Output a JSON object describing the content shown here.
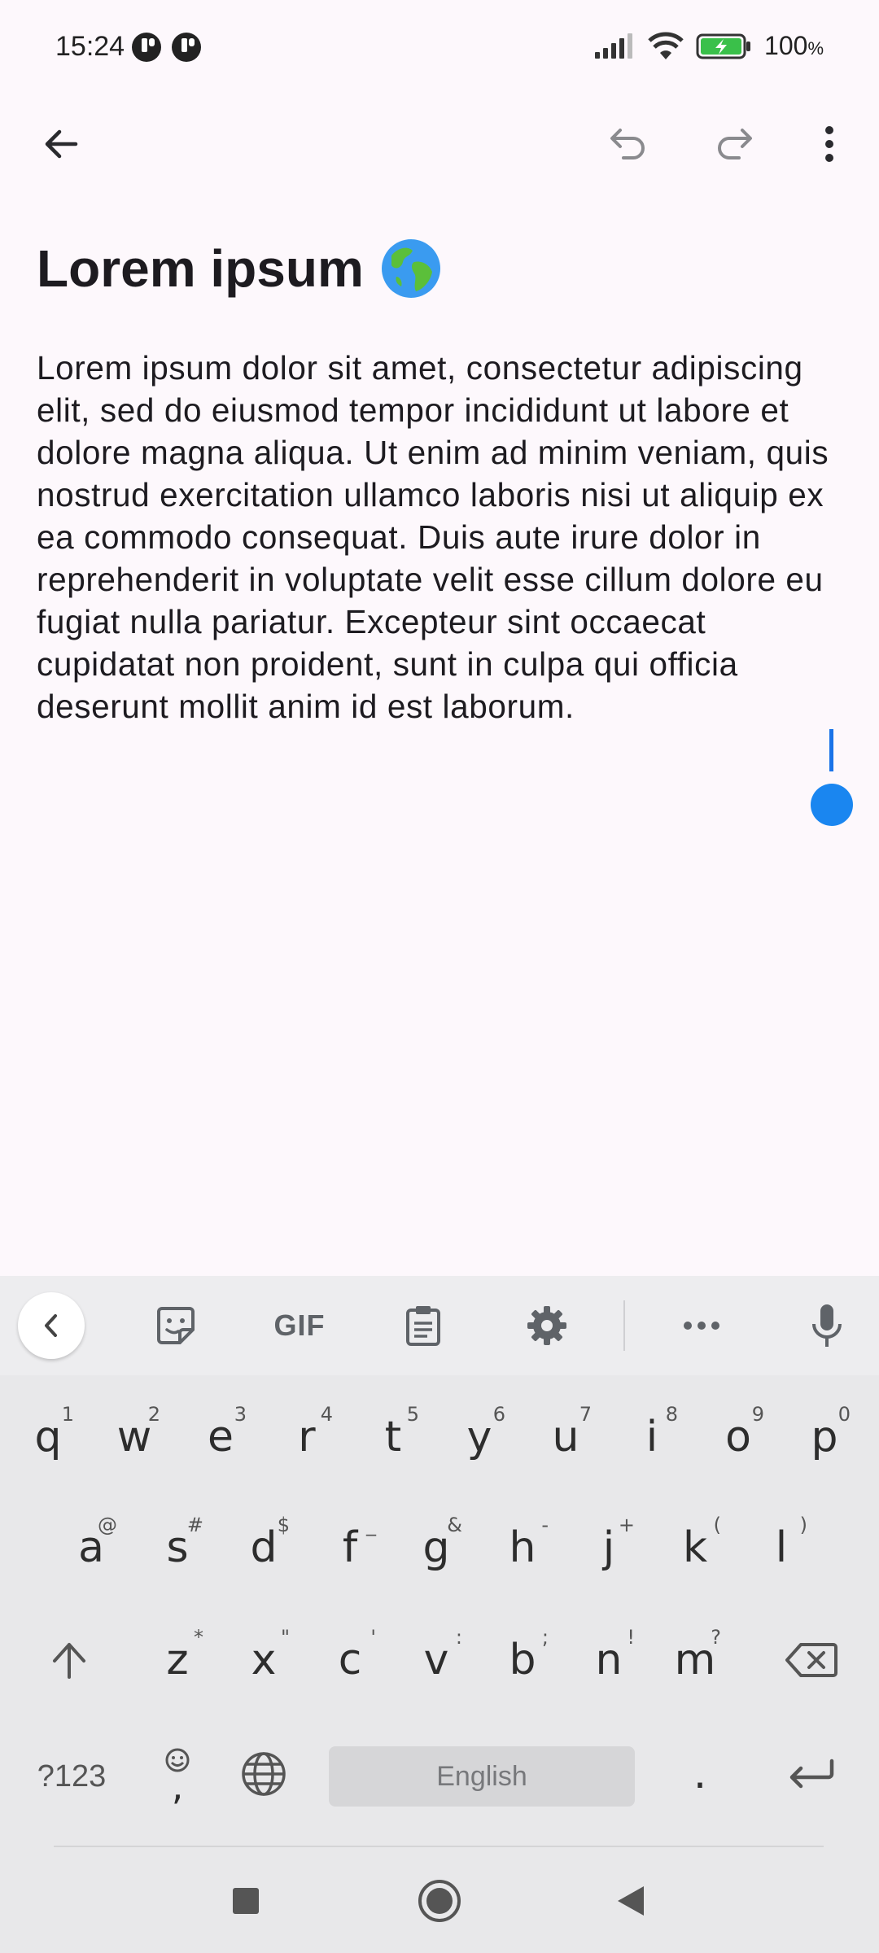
{
  "status_bar": {
    "time": "15:24",
    "battery_percent": "100",
    "battery_percent_symbol": "%"
  },
  "note": {
    "title": "Lorem ipsum",
    "title_emoji": "🌍",
    "body": "Lorem ipsum dolor sit amet, consectetur adipiscing elit, sed do eiusmod tempor incididunt ut labore et dolore magna aliqua. Ut enim ad minim veniam, quis nostrud exercitation ullamco laboris nisi ut aliquip ex ea commodo consequat. Duis aute irure dolor in reprehenderit in voluptate velit esse cillum dolore eu fugiat nulla pariatur. Excepteur sint occaecat cupidatat non proident, sunt in culpa qui officia deserunt mollit anim id est laborum."
  },
  "keyboard": {
    "toolbar": {
      "gif_label": "GIF"
    },
    "row1": [
      {
        "key": "q",
        "hint": "1"
      },
      {
        "key": "w",
        "hint": "2"
      },
      {
        "key": "e",
        "hint": "3"
      },
      {
        "key": "r",
        "hint": "4"
      },
      {
        "key": "t",
        "hint": "5"
      },
      {
        "key": "y",
        "hint": "6"
      },
      {
        "key": "u",
        "hint": "7"
      },
      {
        "key": "i",
        "hint": "8"
      },
      {
        "key": "o",
        "hint": "9"
      },
      {
        "key": "p",
        "hint": "0"
      }
    ],
    "row2": [
      {
        "key": "a",
        "hint": "@"
      },
      {
        "key": "s",
        "hint": "#"
      },
      {
        "key": "d",
        "hint": "$"
      },
      {
        "key": "f",
        "hint": "_"
      },
      {
        "key": "g",
        "hint": "&"
      },
      {
        "key": "h",
        "hint": "-"
      },
      {
        "key": "j",
        "hint": "+"
      },
      {
        "key": "k",
        "hint": "("
      },
      {
        "key": "l",
        "hint": ")"
      }
    ],
    "row3": [
      {
        "key": "z",
        "hint": "*"
      },
      {
        "key": "x",
        "hint": "\""
      },
      {
        "key": "c",
        "hint": "'"
      },
      {
        "key": "v",
        "hint": ":"
      },
      {
        "key": "b",
        "hint": ";"
      },
      {
        "key": "n",
        "hint": "!"
      },
      {
        "key": "m",
        "hint": "?"
      }
    ],
    "symbols_label": "?123",
    "comma": ",",
    "space_label": "English",
    "period": "."
  },
  "colors": {
    "accent": "#1A86F0",
    "background": "#FDF8FC",
    "keyboard_bg": "#E8E8EA"
  },
  "icons": [
    "back-arrow-icon",
    "undo-icon",
    "redo-icon",
    "more-vert-icon",
    "chevron-left-icon",
    "sticker-icon",
    "clipboard-icon",
    "gear-icon",
    "more-horiz-icon",
    "mic-icon",
    "shift-icon",
    "backspace-icon",
    "emoji-icon",
    "globe-icon",
    "enter-icon",
    "nav-recents-icon",
    "nav-home-icon",
    "nav-back-icon"
  ]
}
